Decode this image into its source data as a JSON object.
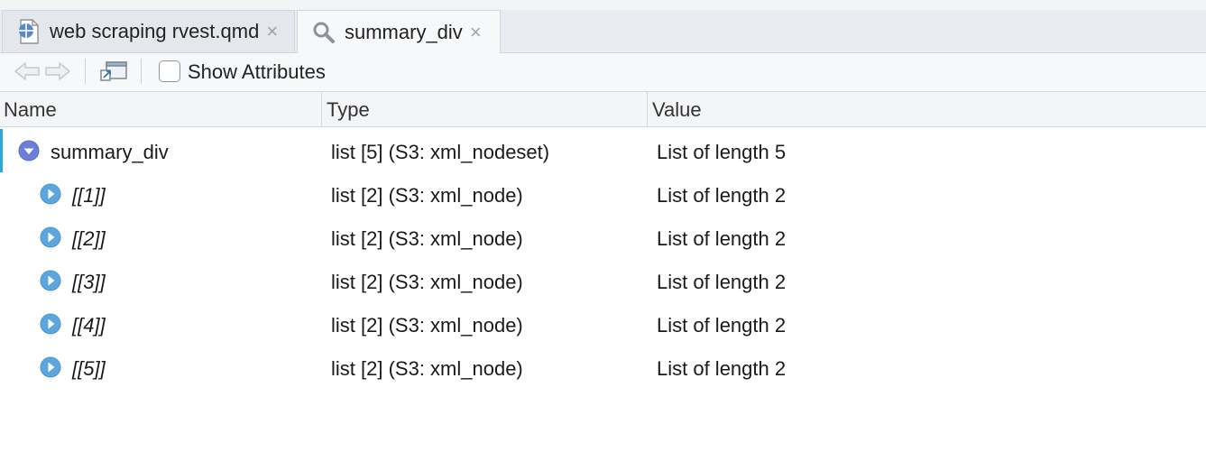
{
  "tabs": [
    {
      "label": "web scraping rvest.qmd",
      "icon": "quarto-globe-icon",
      "close": "×"
    },
    {
      "label": "summary_div",
      "icon": "search-icon",
      "close": "×"
    }
  ],
  "toolbar": {
    "back_icon": "arrow-left-icon",
    "forward_icon": "arrow-right-icon",
    "popout_icon": "popout-icon",
    "show_attributes_label": "Show Attributes",
    "show_attributes_checked": false
  },
  "columns": {
    "name": "Name",
    "type": "Type",
    "value": "Value"
  },
  "rows": [
    {
      "name": "summary_div",
      "type": "list [5] (S3: xml_nodeset)",
      "value": "List of length 5",
      "expanded": true
    },
    {
      "name": "[[1]]",
      "type": "list [2] (S3: xml_node)",
      "value": "List of length 2",
      "expanded": false
    },
    {
      "name": "[[2]]",
      "type": "list [2] (S3: xml_node)",
      "value": "List of length 2",
      "expanded": false
    },
    {
      "name": "[[3]]",
      "type": "list [2] (S3: xml_node)",
      "value": "List of length 2",
      "expanded": false
    },
    {
      "name": "[[4]]",
      "type": "list [2] (S3: xml_node)",
      "value": "List of length 2",
      "expanded": false
    },
    {
      "name": "[[5]]",
      "type": "list [2] (S3: xml_node)",
      "value": "List of length 2",
      "expanded": false
    }
  ],
  "colors": {
    "expander_open": "#6b7fd9",
    "expander_closed": "#5ba7dd",
    "selection_bar": "#2aa7e0"
  }
}
